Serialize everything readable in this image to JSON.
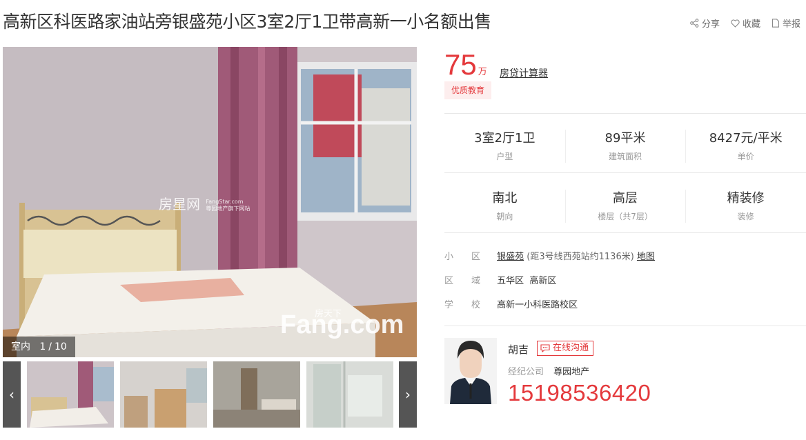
{
  "title": "高新区科医路家油站旁银盛苑小区3室2厅1卫带高新一小名额出售",
  "actions": {
    "share": "分享",
    "favorite": "收藏",
    "report": "举报"
  },
  "gallery": {
    "category": "室内",
    "current": "1",
    "separator": "/",
    "total": "10",
    "watermark_left": "房星网",
    "watermark_left_sub1": "FangStar.com",
    "watermark_left_sub2": "尊园地产旗下网站",
    "watermark_right_top": "房天下",
    "watermark_right": "Fang.com"
  },
  "price": {
    "value": "75",
    "unit": "万",
    "calculator": "房贷计算器",
    "tag": "优质教育"
  },
  "stats": [
    {
      "value": "3室2厅1卫",
      "label": "户型"
    },
    {
      "value": "89平米",
      "label": "建筑面积"
    },
    {
      "value": "8427元/平米",
      "label": "单价"
    },
    {
      "value": "南北",
      "label": "朝向"
    },
    {
      "value": "高层",
      "label": "楼层（共7层）"
    },
    {
      "value": "精装修",
      "label": "装修"
    }
  ],
  "info": {
    "community_label": "小区",
    "community": "银盛苑",
    "community_note": "(距3号线西苑站约1136米)",
    "map": "地图",
    "area_label": "区域",
    "district": "五华区",
    "subarea": "高新区",
    "school_label": "学校",
    "school": "高新一小科医路校区"
  },
  "agent": {
    "name": "胡吉",
    "chat": "在线沟通",
    "company_label": "经纪公司",
    "company": "尊园地产",
    "phone": "15198536420"
  },
  "colors": {
    "accent": "#e4393c",
    "tag_bg": "#fdeeee"
  }
}
